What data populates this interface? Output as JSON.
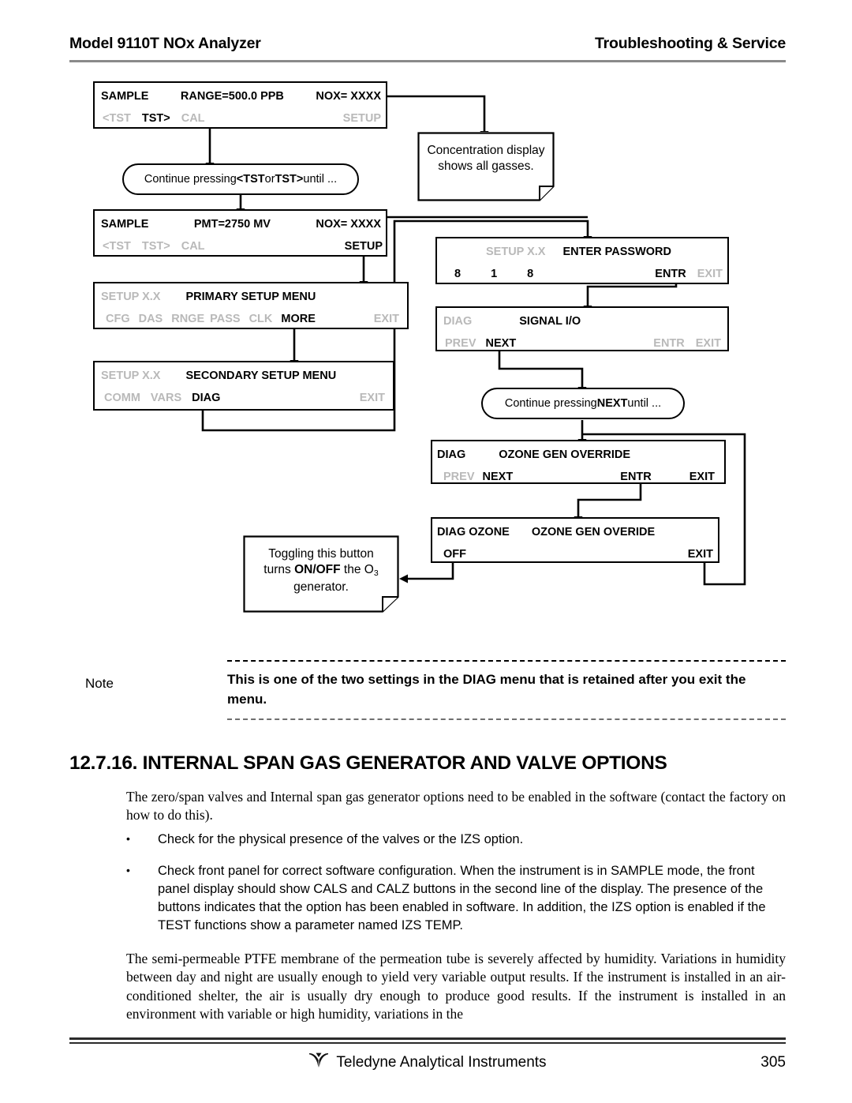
{
  "header": {
    "left": "Model 9110T NOx Analyzer",
    "right": "Troubleshooting & Service"
  },
  "diagram": {
    "panels": [
      {
        "name": "sample-range-display",
        "line1": [
          {
            "text": "SAMPLE",
            "state": "lit"
          },
          {
            "text": "RANGE=500.0 PPB",
            "state": "lit"
          },
          {
            "text": "NOX= XXXX",
            "state": "lit"
          }
        ],
        "line2": [
          {
            "text": "<TST",
            "state": "dim"
          },
          {
            "text": "TST>",
            "state": "lit"
          },
          {
            "text": "CAL",
            "state": "dim"
          },
          {
            "text": "SETUP",
            "state": "dim"
          }
        ]
      },
      {
        "name": "sample-pmt-display",
        "line1": [
          {
            "text": "SAMPLE",
            "state": "lit"
          },
          {
            "text": "PMT=2750 MV",
            "state": "lit"
          },
          {
            "text": "NOX= XXXX",
            "state": "lit"
          }
        ],
        "line2": [
          {
            "text": "<TST",
            "state": "dim"
          },
          {
            "text": "TST>",
            "state": "dim"
          },
          {
            "text": "CAL",
            "state": "dim"
          },
          {
            "text": "SETUP",
            "state": "lit"
          }
        ]
      },
      {
        "name": "primary-setup-menu",
        "line1": [
          {
            "text": "SETUP X.X",
            "state": "dim"
          },
          {
            "text": "PRIMARY SETUP MENU",
            "state": "lit"
          }
        ],
        "line2": [
          {
            "text": "CFG",
            "state": "dim"
          },
          {
            "text": "DAS",
            "state": "dim"
          },
          {
            "text": "RNGE",
            "state": "dim"
          },
          {
            "text": "PASS",
            "state": "dim"
          },
          {
            "text": "CLK",
            "state": "dim"
          },
          {
            "text": "MORE",
            "state": "lit"
          },
          {
            "text": "EXIT",
            "state": "dim"
          }
        ]
      },
      {
        "name": "secondary-setup-menu",
        "line1": [
          {
            "text": "SETUP X.X",
            "state": "dim"
          },
          {
            "text": "SECONDARY SETUP MENU",
            "state": "lit"
          }
        ],
        "line2": [
          {
            "text": "COMM",
            "state": "dim"
          },
          {
            "text": "VARS",
            "state": "dim"
          },
          {
            "text": "DIAG",
            "state": "lit"
          },
          {
            "text": "EXIT",
            "state": "dim"
          }
        ]
      },
      {
        "name": "enter-password",
        "line1": [
          {
            "text": "SETUP X.X",
            "state": "dim"
          },
          {
            "text": "ENTER PASSWORD",
            "state": "lit"
          }
        ],
        "line2": [
          {
            "text": "8",
            "state": "lit"
          },
          {
            "text": "1",
            "state": "lit"
          },
          {
            "text": "8",
            "state": "lit"
          },
          {
            "text": "ENTR",
            "state": "lit"
          },
          {
            "text": "EXIT",
            "state": "dim"
          }
        ]
      },
      {
        "name": "signal-io",
        "line1": [
          {
            "text": "DIAG",
            "state": "dim"
          },
          {
            "text": "SIGNAL I/O",
            "state": "lit"
          }
        ],
        "line2": [
          {
            "text": "PREV",
            "state": "dim"
          },
          {
            "text": "NEXT",
            "state": "lit"
          },
          {
            "text": "ENTR",
            "state": "dim"
          },
          {
            "text": "EXIT",
            "state": "dim"
          }
        ]
      },
      {
        "name": "ozone-gen-override",
        "line1": [
          {
            "text": "DIAG",
            "state": "lit"
          },
          {
            "text": "OZONE GEN OVERRIDE",
            "state": "lit"
          }
        ],
        "line2": [
          {
            "text": "PREV",
            "state": "dim"
          },
          {
            "text": "NEXT",
            "state": "lit"
          },
          {
            "text": "ENTR",
            "state": "lit"
          },
          {
            "text": "EXIT",
            "state": "lit"
          }
        ]
      },
      {
        "name": "diag-ozone-override",
        "line1": [
          {
            "text": "DIAG OZONE",
            "state": "lit"
          },
          {
            "text": "OZONE GEN OVERIDE",
            "state": "lit"
          }
        ],
        "line2": [
          {
            "text": "OFF",
            "state": "lit"
          },
          {
            "text": "EXIT",
            "state": "lit"
          }
        ]
      }
    ],
    "pills": [
      {
        "name": "continue-pressing-tst",
        "parts": [
          {
            "text": "Continue pressing ",
            "bold": false
          },
          {
            "text": "<TST",
            "bold": true
          },
          {
            "text": " or ",
            "bold": false
          },
          {
            "text": "TST>",
            "bold": true
          },
          {
            "text": " until ...",
            "bold": false
          }
        ]
      },
      {
        "name": "continue-pressing-next",
        "parts": [
          {
            "text": "Continue pressing ",
            "bold": false
          },
          {
            "text": "NEXT",
            "bold": true
          },
          {
            "text": " until ...",
            "bold": false
          }
        ]
      }
    ],
    "notes": [
      {
        "name": "concentration-display-note",
        "line1": "Concentration display",
        "line2": "shows all gasses."
      },
      {
        "name": "toggle-onoff-note",
        "line1_a": "Toggling this button",
        "line2_a": "turns ",
        "line2_b": "ON/OFF",
        "line2_c": " the O",
        "line2_sub": "3",
        "line3": "generator."
      }
    ]
  },
  "admonition": {
    "label": "Note",
    "text": "This is one of the two settings in the DIAG menu that is retained after you exit the menu."
  },
  "section": {
    "heading": "12.7.16. INTERNAL SPAN GAS GENERATOR AND VALVE OPTIONS",
    "intro": "The zero/span valves and Internal span gas generator options need to be enabled in the software (contact the factory on how to do this).",
    "bullet_marker": "•",
    "bullets": [
      "Check for the physical presence of the valves or the IZS option.",
      "Check front panel for correct software configuration.  When the instrument is in SAMPLE mode, the front panel display should show CALS and CALZ buttons in the second line of the display.  The presence of the buttons indicates that the option has been enabled in software.  In addition, the IZS option is enabled if the TEST functions show a parameter named IZS TEMP."
    ],
    "humidity": "The semi-permeable PTFE membrane of the permeation tube is severely affected by humidity.  Variations in humidity between day and night are usually enough to yield very variable output results.  If the instrument is installed in an air-conditioned shelter, the air is usually dry enough to produce good results.  If the instrument is installed in an environment with variable or high humidity, variations in the"
  },
  "footer": {
    "company": "Teledyne Analytical Instruments",
    "page": "305"
  },
  "colors": {
    "dim_text": "#b9b9b9",
    "rule": "#8a8a8a",
    "ink": "#000000"
  }
}
